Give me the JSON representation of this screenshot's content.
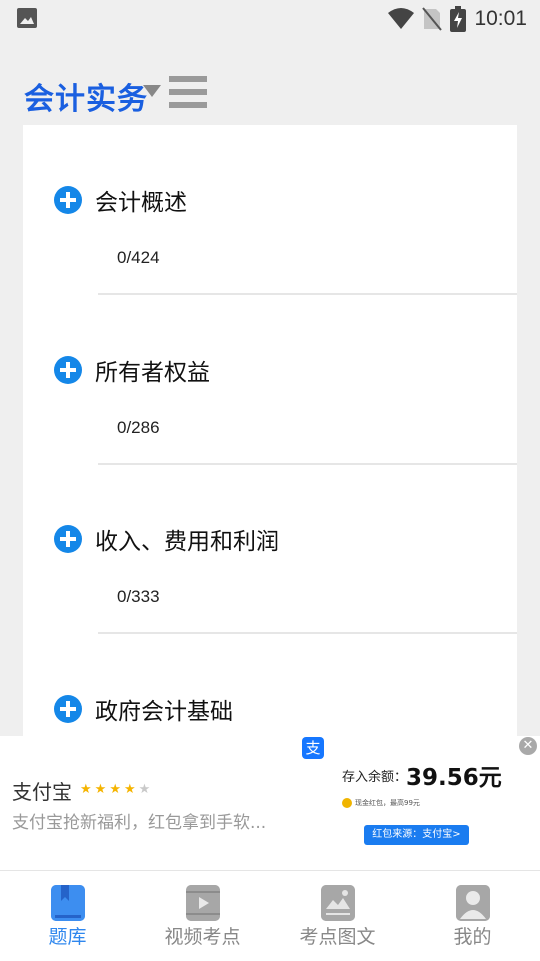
{
  "status_bar": {
    "time": "10:01",
    "icons": [
      "image-icon",
      "wifi-icon",
      "no-sim-icon",
      "battery-charging-icon"
    ]
  },
  "header": {
    "subject": "会计实务",
    "icons": [
      "dropdown-caret-icon",
      "menu-icon"
    ]
  },
  "chapters": [
    {
      "title": "会计概述",
      "progress": "0/424"
    },
    {
      "title": "所有者权益",
      "progress": "0/286"
    },
    {
      "title": "收入、费用和利润",
      "progress": "0/333"
    },
    {
      "title": "政府会计基础",
      "progress": ""
    }
  ],
  "ad": {
    "app_name": "支付宝",
    "app_icon_glyph": "支",
    "rating": 4,
    "rating_max": 5,
    "description": "支付宝抢新福利，红包拿到手软...",
    "balance_label": "存入余额：",
    "balance_value": "39.56元",
    "small_text": "现金红包，最高99元",
    "button_label": "红包来源：支付宝>",
    "close_glyph": "✕"
  },
  "bottom_nav": [
    {
      "label": "题库",
      "icon": "question-bank-icon",
      "active": true
    },
    {
      "label": "视频考点",
      "icon": "video-icon",
      "active": false
    },
    {
      "label": "考点图文",
      "icon": "image-text-icon",
      "active": false
    },
    {
      "label": "我的",
      "icon": "profile-icon",
      "active": false
    }
  ],
  "colors": {
    "accent": "#1a5fe0",
    "plus": "#1487e8",
    "nav_active": "#2f87ee",
    "background": "#efefef"
  }
}
